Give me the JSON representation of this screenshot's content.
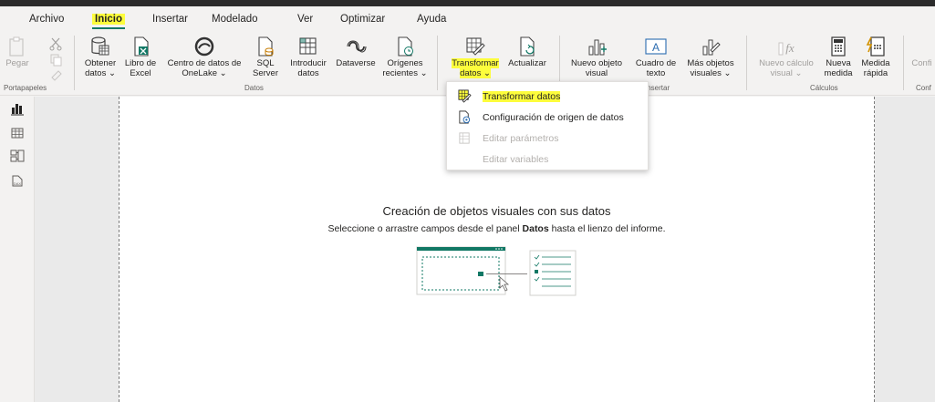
{
  "menu": {
    "items": [
      {
        "label": "Archivo"
      },
      {
        "label": "Inicio"
      },
      {
        "label": "Insertar"
      },
      {
        "label": "Modelado"
      },
      {
        "label": "Ver"
      },
      {
        "label": "Optimizar"
      },
      {
        "label": "Ayuda"
      }
    ],
    "active": "Inicio"
  },
  "ribbon": {
    "portapapeles": {
      "paste": "Pegar",
      "group": "Portapapeles"
    },
    "datos": {
      "get_data": [
        "Obtener",
        "datos ⌄"
      ],
      "excel": [
        "Libro de",
        "Excel"
      ],
      "onelake": [
        "Centro de datos de",
        "OneLake ⌄"
      ],
      "sql": [
        "SQL",
        "Server"
      ],
      "enter_data": [
        "Introducir",
        "datos"
      ],
      "dataverse": [
        "Dataverse",
        ""
      ],
      "recent": [
        "Orígenes",
        "recientes ⌄"
      ],
      "group": "Datos"
    },
    "consultas": {
      "transform": [
        "Transformar",
        "datos ⌄"
      ],
      "refresh": [
        "Actualizar",
        ""
      ]
    },
    "insertar": {
      "new_visual": [
        "Nuevo objeto",
        "visual"
      ],
      "text_box": [
        "Cuadro de",
        "texto"
      ],
      "more_visuals": [
        "Más objetos",
        "visuales ⌄"
      ],
      "group": "Insertar"
    },
    "calculos": {
      "new_calc": [
        "Nuevo cálculo",
        "visual ⌄"
      ],
      "new_measure": [
        "Nueva",
        "medida"
      ],
      "quick_measure": [
        "Medida",
        "rápida"
      ],
      "group": "Cálculos"
    },
    "config": {
      "label": "Confi",
      "group": "Conf"
    }
  },
  "dropdown": {
    "items": [
      {
        "label": "Transformar datos",
        "enabled": true,
        "highlighted": true
      },
      {
        "label": "Configuración de origen de datos",
        "enabled": true
      },
      {
        "label": "Editar parámetros",
        "enabled": false
      },
      {
        "label": "Editar variables",
        "enabled": false
      }
    ]
  },
  "canvas": {
    "title": "Creación de objetos visuales con sus datos",
    "subtitle_before": "Seleccione o arrastre campos desde el panel ",
    "subtitle_bold": "Datos",
    "subtitle_after": " hasta el lienzo del informe."
  },
  "colors": {
    "highlight": "#fdfd3c",
    "accent": "#117865",
    "chrome": "#f3f2f1"
  }
}
